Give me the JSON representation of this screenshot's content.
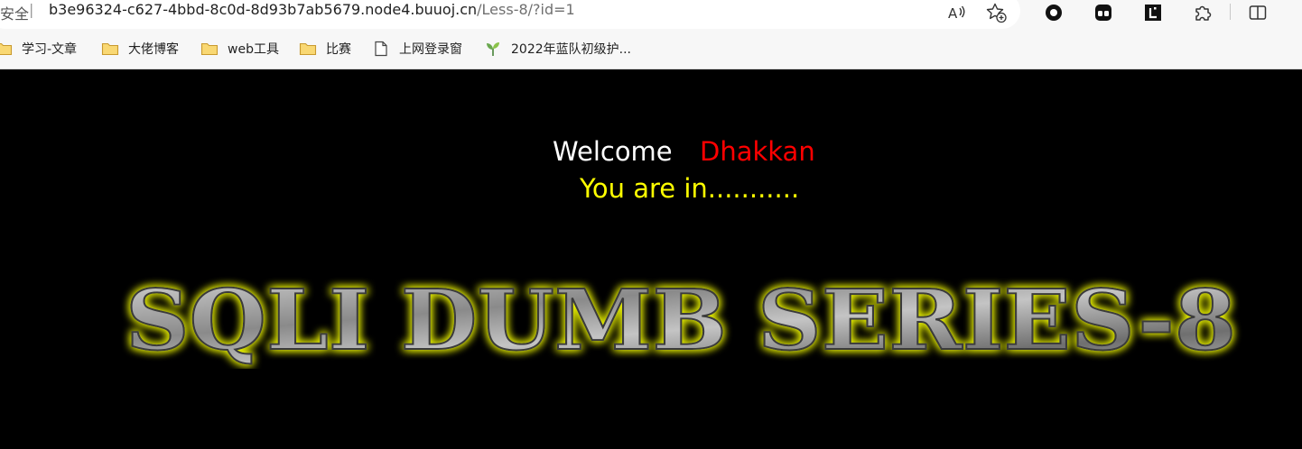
{
  "browser": {
    "security_label": "安全",
    "separator": "|",
    "url_host": "b3e96324-c627-4bbd-8c0d-8d93b7ab5679.node4.buuoj.cn",
    "url_path": "/Less-8/?id=1",
    "toolbar_icons": [
      "read-aloud-icon",
      "favorite-add-icon",
      "record-icon",
      "extension-dual-icon",
      "extension-l-icon",
      "extensions-puzzle-icon",
      "split-screen-icon"
    ]
  },
  "bookmarks": [
    {
      "label": "学习-文章",
      "icon": "folder-icon"
    },
    {
      "label": "大佬博客",
      "icon": "folder-icon"
    },
    {
      "label": "web工具",
      "icon": "folder-icon"
    },
    {
      "label": "比赛",
      "icon": "folder-icon"
    },
    {
      "label": "上网登录窗",
      "icon": "page-icon"
    },
    {
      "label": "2022年蓝队初级护...",
      "icon": "sprout-icon"
    }
  ],
  "page": {
    "welcome_word": "Welcome",
    "welcome_name": "Dhakkan",
    "status_text": "You are in...........",
    "banner_text": "SQLI DUMB SERIES-8",
    "colors": {
      "background": "#000000",
      "welcome": "#ffffff",
      "name": "#ff0000",
      "status": "#ffff00",
      "banner_glow": "#e8f000"
    }
  }
}
